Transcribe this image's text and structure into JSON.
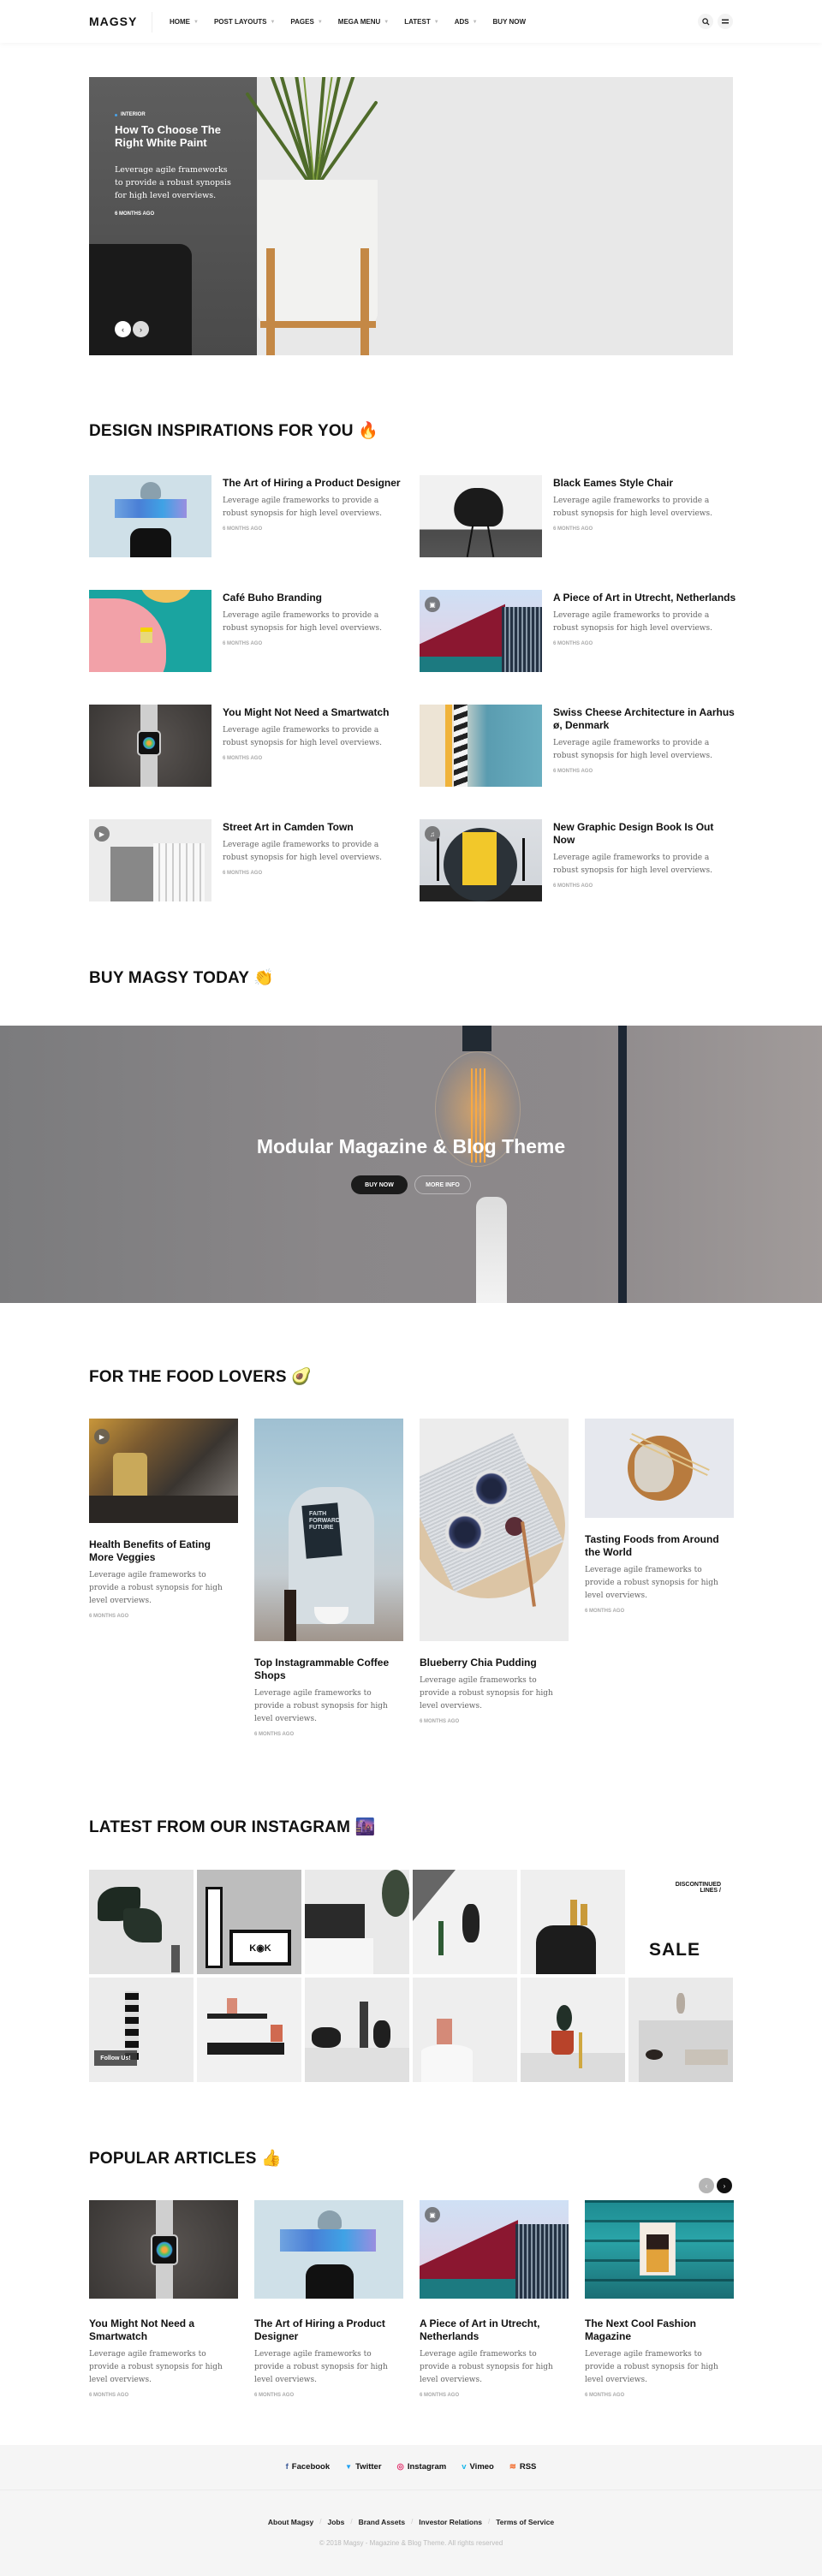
{
  "header": {
    "logo": "MAGSY",
    "nav": [
      {
        "label": "HOME",
        "has_dropdown": true
      },
      {
        "label": "POST LAYOUTS",
        "has_dropdown": true
      },
      {
        "label": "PAGES",
        "has_dropdown": true
      },
      {
        "label": "MEGA MENU",
        "has_dropdown": true
      },
      {
        "label": "LATEST",
        "has_dropdown": true
      },
      {
        "label": "ADS",
        "has_dropdown": true
      },
      {
        "label": "BUY NOW",
        "has_dropdown": false
      }
    ],
    "icons": {
      "search": "search-icon",
      "menu": "menu-icon"
    }
  },
  "hero": {
    "category": "INTERIOR",
    "title": "How To Choose The Right White Paint",
    "excerpt": "Leverage agile frameworks to provide a robust synopsis for high level overviews.",
    "time": "6 MONTHS AGO",
    "prev": "‹",
    "next": "›",
    "accent": "#4aa3e8"
  },
  "design": {
    "title": "DESIGN INSPIRATIONS FOR YOU",
    "emoji": "🔥",
    "items": [
      {
        "title": "The Art of Hiring a Product Designer",
        "excerpt": "Leverage agile frameworks to provide a robust synopsis for high level overviews.",
        "time": "6 MONTHS AGO"
      },
      {
        "title": "Black Eames Style Chair",
        "excerpt": "Leverage agile frameworks to provide a robust synopsis for high level overviews.",
        "time": "6 MONTHS AGO"
      },
      {
        "title": "Café Buho Branding",
        "excerpt": "Leverage agile frameworks to provide a robust synopsis for high level overviews.",
        "time": "6 MONTHS AGO"
      },
      {
        "title": "A Piece of Art in Utrecht, Netherlands",
        "excerpt": "Leverage agile frameworks to provide a robust synopsis for high level overviews.",
        "time": "6 MONTHS AGO",
        "format_icon": "gallery-icon"
      },
      {
        "title": "You Might Not Need a Smartwatch",
        "excerpt": "Leverage agile frameworks to provide a robust synopsis for high level overviews.",
        "time": "6 MONTHS AGO"
      },
      {
        "title": "Swiss Cheese Architecture in Aarhus ø, Denmark",
        "excerpt": "Leverage agile frameworks to provide a robust synopsis for high level overviews.",
        "time": "6 MONTHS AGO"
      },
      {
        "title": "Street Art in Camden Town",
        "excerpt": "Leverage agile frameworks to provide a robust synopsis for high level overviews.",
        "time": "6 MONTHS AGO",
        "format_icon": "video-icon"
      },
      {
        "title": "New Graphic Design Book Is Out Now",
        "excerpt": "Leverage agile frameworks to provide a robust synopsis for high level overviews.",
        "time": "6 MONTHS AGO",
        "format_icon": "audio-icon"
      }
    ]
  },
  "promo": {
    "section_title": "BUY MAGSY TODAY",
    "emoji": "👏",
    "title": "Modular Magazine & Blog Theme",
    "buy_label": "BUY NOW",
    "info_label": "MORE INFO"
  },
  "food": {
    "title": "FOR THE FOOD LOVERS",
    "emoji": "🥑",
    "items": [
      {
        "title": "Health Benefits of Eating More Veggies",
        "excerpt": "Leverage agile frameworks to provide a robust synopsis for high level overviews.",
        "time": "6 MONTHS AGO",
        "format_icon": "video-icon"
      },
      {
        "title": "Top Instagrammable Coffee Shops",
        "excerpt": "Leverage agile frameworks to provide a robust synopsis for high level overviews.",
        "time": "6 MONTHS AGO"
      },
      {
        "title": "Blueberry Chia Pudding",
        "excerpt": "Leverage agile frameworks to provide a robust synopsis for high level overviews.",
        "time": "6 MONTHS AGO"
      },
      {
        "title": "Tasting Foods from Around the World",
        "excerpt": "Leverage agile frameworks to provide a robust synopsis for high level overviews.",
        "time": "6 MONTHS AGO"
      }
    ]
  },
  "instagram": {
    "title": "LATEST FROM OUR INSTAGRAM",
    "emoji": "🌆",
    "follow_label": "Follow Us!",
    "sale_top": "DISCONTINUED LINES /",
    "sale_big": "SALE"
  },
  "popular": {
    "title": "POPULAR ARTICLES",
    "emoji": "👍",
    "prev": "‹",
    "next": "›",
    "items": [
      {
        "title": "You Might Not Need a Smartwatch",
        "excerpt": "Leverage agile frameworks to provide a robust synopsis for high level overviews.",
        "time": "6 MONTHS AGO"
      },
      {
        "title": "The Art of Hiring a Product Designer",
        "excerpt": "Leverage agile frameworks to provide a robust synopsis for high level overviews.",
        "time": "6 MONTHS AGO"
      },
      {
        "title": "A Piece of Art in Utrecht, Netherlands",
        "excerpt": "Leverage agile frameworks to provide a robust synopsis for high level overviews.",
        "time": "6 MONTHS AGO",
        "format_icon": "gallery-icon"
      },
      {
        "title": "The Next Cool Fashion Magazine",
        "excerpt": "Leverage agile frameworks to provide a robust synopsis for high level overviews.",
        "time": "6 MONTHS AGO"
      }
    ]
  },
  "footer": {
    "social": [
      {
        "label": "Facebook",
        "glyph": "f",
        "color": "#3b5998"
      },
      {
        "label": "Twitter",
        "glyph": "🐦",
        "color": "#1da1f2"
      },
      {
        "label": "Instagram",
        "glyph": "◎",
        "color": "#e1306c"
      },
      {
        "label": "Vimeo",
        "glyph": "v",
        "color": "#1ab7ea"
      },
      {
        "label": "RSS",
        "glyph": "≋",
        "color": "#f26522"
      }
    ],
    "links": [
      "About Magsy",
      "Jobs",
      "Brand Assets",
      "Investor Relations",
      "Terms of Service"
    ],
    "separator": "/",
    "copyright": "© 2018 Magsy - Magazine & Blog Theme. All rights reserved"
  }
}
